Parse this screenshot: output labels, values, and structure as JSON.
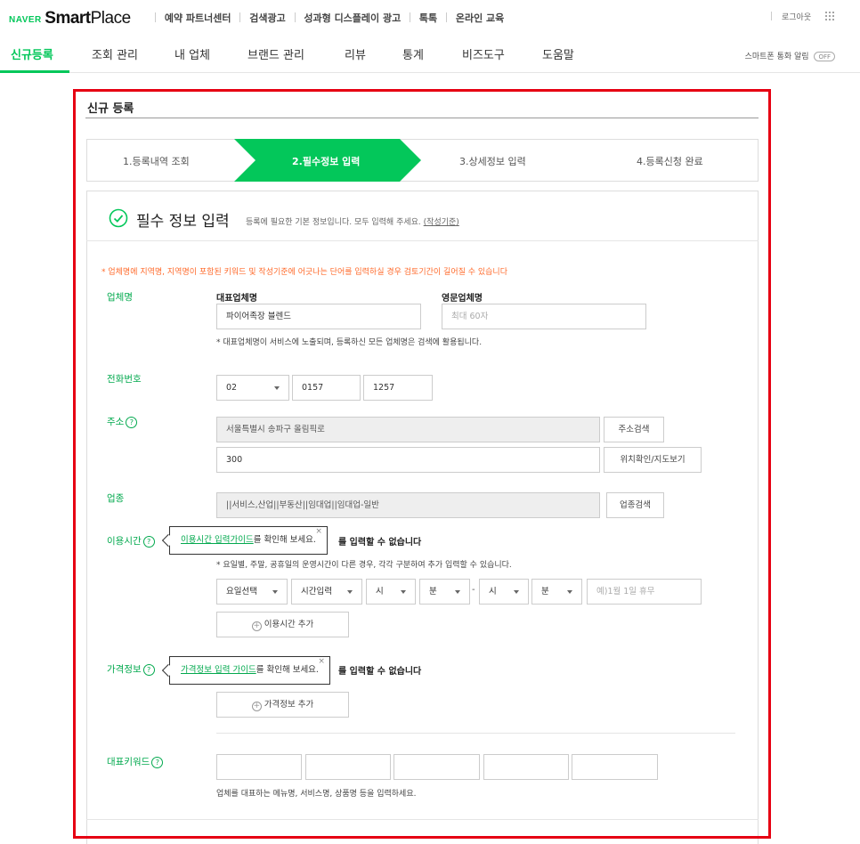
{
  "brand": {
    "naver": "NAVER",
    "smart": "Smart",
    "place": "Place"
  },
  "top_nav": [
    "예약 파트너센터",
    "검색광고",
    "성과형 디스플레이 광고",
    "톡톡",
    "온라인 교육"
  ],
  "top_right": {
    "logout": "로그아웃",
    "apps_icon": "grid-icon"
  },
  "main_nav": {
    "tabs": [
      "신규등록",
      "조회 관리",
      "내 업체",
      "브랜드 관리",
      "리뷰",
      "통계",
      "비즈도구",
      "도움말"
    ],
    "active_tab": "신규등록",
    "notify_label": "스마트폰 통화 알림",
    "notify_toggle": "OFF"
  },
  "page_title": "신규 등록",
  "steps": [
    {
      "label": "1.등록내역 조회"
    },
    {
      "label": "2.필수정보 입력",
      "active": true
    },
    {
      "label": "3.상세정보 입력"
    },
    {
      "label": "4.등록신청 완료"
    }
  ],
  "form": {
    "title": "필수 정보 입력",
    "desc": "등록에 필요한 기본 정보입니다. 모두 입력해 주세요.",
    "desc_link": "(작성기준)",
    "warning": "* 업체명에 지역명, 지역명이 포함된 키워드 및 작성기준에 어긋나는 단어를 입력하실 경우 검토기간이 길어질 수 있습니다",
    "business_name": {
      "label": "업체명",
      "rep_label": "대표업체명",
      "rep_value": "파이어족장 블렌드",
      "eng_label": "영문업체명",
      "eng_placeholder": "최대 60자",
      "help": "* 대표업체명이 서비스에 노출되며, 등록하신 모든 업체명은 검색에 활용됩니다."
    },
    "phone": {
      "label": "전화번호",
      "area": "02",
      "mid": "0157",
      "last": "1257"
    },
    "address": {
      "label": "주소",
      "road": "서울특별시 송파구 올림픽로",
      "detail": "300",
      "search_btn": "주소검색",
      "map_btn": "위치확인/지도보기"
    },
    "category": {
      "label": "업종",
      "value": "||서비스,산업||부동산||임대업||임대업-일반",
      "search_btn": "업종검색"
    },
    "hours": {
      "label": "이용시간",
      "tooltip_link": "이용시간 입력가이드",
      "tooltip_text": "를 확인해 보세요.",
      "tooltip_close": "×",
      "bold_notice_tail": "를 입력할 수 없습니다",
      "help": "* 요일별, 주말, 공휴일의 운영시간이 다른 경우, 각각 구분하여 추가 입력할 수 있습니다.",
      "day_select": "요일선택",
      "time_select": "시간입력",
      "hour1": "시",
      "min1": "분",
      "dash": "-",
      "hour2": "시",
      "min2": "분",
      "holiday_placeholder": "예)1월 1일 휴무",
      "add_btn": "이용시간 추가"
    },
    "price": {
      "label": "가격정보",
      "tooltip_link": "가격정보 입력 가이드",
      "tooltip_text": "를 확인해 보세요.",
      "tooltip_close": "×",
      "bold_notice_tail": "를 입력할 수 없습니다",
      "add_btn": "가격정보 추가"
    },
    "keywords": {
      "label": "대표키워드",
      "help": "업체를 대표하는 메뉴명, 서비스명, 상품명 등을 입력하세요."
    },
    "help_icon": "?"
  }
}
